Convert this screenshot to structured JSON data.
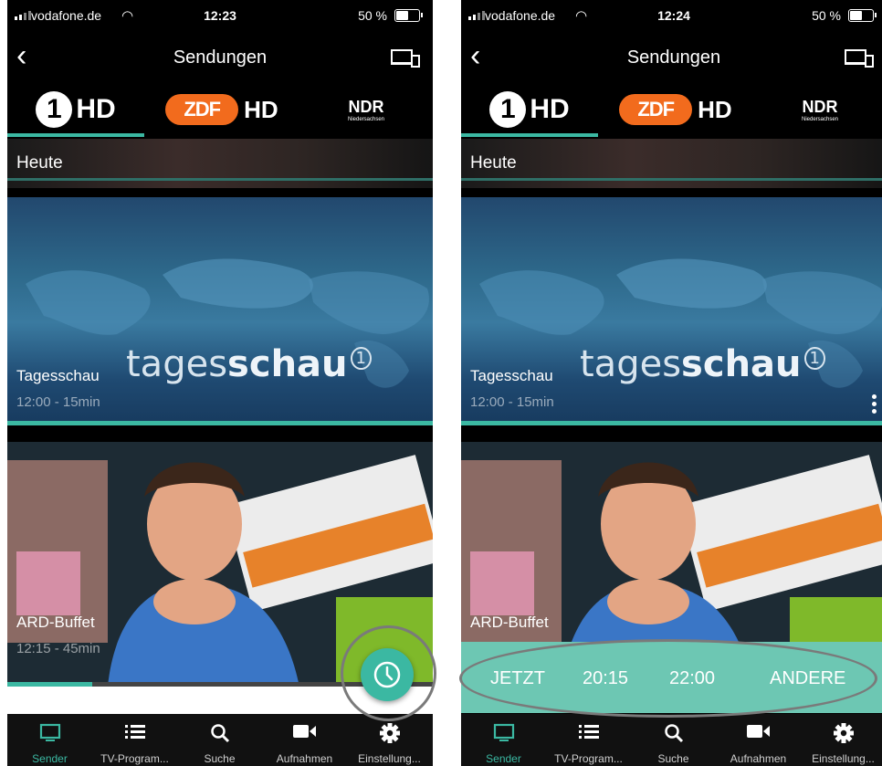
{
  "colors": {
    "accent": "#3bb8a2",
    "zdf_orange": "#f26b1d",
    "timebar": "#6dc7b3",
    "background": "#000000"
  },
  "screens": [
    {
      "status": {
        "carrier": "vodafone.de",
        "time": "12:23",
        "battery": "50 %"
      },
      "nav": {
        "title": "Sendungen",
        "back_icon": "chevron-left-icon",
        "devices_icon": "devices-icon"
      },
      "channels": [
        {
          "id": "ard",
          "logo": "HD",
          "active": true
        },
        {
          "id": "zdf",
          "logo_pill": "ZDF",
          "logo_suffix": "HD"
        },
        {
          "id": "ndr",
          "logo": "NDR",
          "sub": "Niedersachsen"
        }
      ],
      "day_header": "Heute",
      "programs": [
        {
          "title": "Tagesschau",
          "time": "12:00 - 15min",
          "brand_light": "tages",
          "brand_bold": "schau"
        },
        {
          "title": "ARD-Buffet",
          "time": "12:15 - 45min",
          "progress": 0.2
        }
      ],
      "fab_icon": "clock-icon"
    },
    {
      "status": {
        "carrier": "vodafone.de",
        "time": "12:24",
        "battery": "50 %"
      },
      "nav": {
        "title": "Sendungen"
      },
      "day_header": "Heute",
      "programs": [
        {
          "title": "Tagesschau",
          "time": "12:00 - 15min",
          "brand_light": "tages",
          "brand_bold": "schau"
        },
        {
          "title": "ARD-Buffet"
        }
      ],
      "time_options": [
        "JETZT",
        "20:15",
        "22:00",
        "ANDERE"
      ]
    }
  ],
  "tabbar": [
    {
      "label": "Sender",
      "icon": "tv-icon",
      "active": true
    },
    {
      "label": "TV-Program...",
      "icon": "list-icon"
    },
    {
      "label": "Suche",
      "icon": "search-icon"
    },
    {
      "label": "Aufnahmen",
      "icon": "video-camera-icon"
    },
    {
      "label": "Einstellung...",
      "icon": "gear-icon"
    }
  ]
}
